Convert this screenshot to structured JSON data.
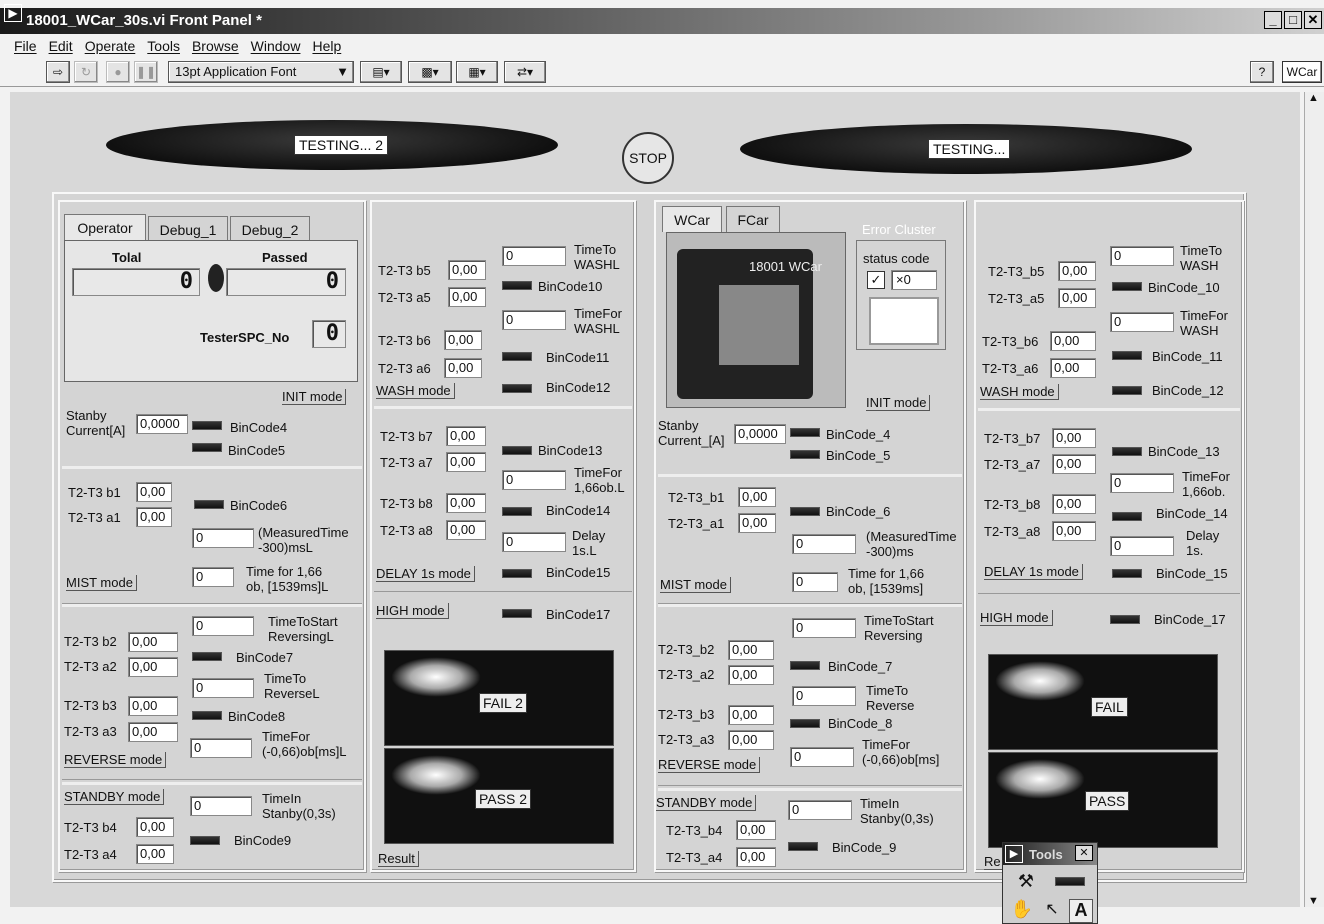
{
  "window": {
    "title": "18001_WCar_30s.vi Front Panel *",
    "right_tab": "WCar"
  },
  "menu": [
    "File",
    "Edit",
    "Operate",
    "Tools",
    "Browse",
    "Window",
    "Help"
  ],
  "toolbar": {
    "font": "13pt Application Font"
  },
  "status": {
    "left": "TESTING... 2",
    "right": "TESTING...",
    "stop": "STOP"
  },
  "left": {
    "tabs": [
      "Operator",
      "Debug_1",
      "Debug_2"
    ],
    "tolal_label": "Tolal",
    "tolal_value": "0",
    "passed_label": "Passed",
    "passed_value": "0",
    "tester_label": "TesterSPC_No",
    "tester_value": "0",
    "init_mode": "INIT mode",
    "stanby_label": "Stanby\nCurrent[A]",
    "stanby_value": "0,0000",
    "bin4": "BinCode4",
    "bin5": "BinCode5",
    "mist": {
      "l1": "T2-T3 b1",
      "v1": "0,00",
      "l2": "T2-T3 a1",
      "v2": "0,00",
      "bin": "BinCode6",
      "n1": "0",
      "t1": "(MeasuredTime\n-300)msL",
      "n2": "0",
      "t2": "Time for 1,66\nob, [1539ms]L",
      "mode": "MIST mode"
    },
    "reverse": {
      "n1": "0",
      "t1": "TimeToStart\nReversingL",
      "l1": "T2-T3 b2",
      "v1": "0,00",
      "l2": "T2-T3 a2",
      "v2": "0,00",
      "bin7": "BinCode7",
      "n2": "0",
      "t2": "TimeTo\nReverseL",
      "l3": "T2-T3 b3",
      "v3": "0,00",
      "l4": "T2-T3 a3",
      "v4": "0,00",
      "bin8": "BinCode8",
      "n3": "0",
      "t3": "TimeFor\n(-0,66)ob[ms]L",
      "mode": "REVERSE mode"
    },
    "standby": {
      "mode": "STANDBY mode",
      "n1": "0",
      "t1": "TimeIn\nStanby(0,3s)",
      "l1": "T2-T3 b4",
      "v1": "0,00",
      "l2": "T2-T3 a4",
      "v2": "0,00",
      "bin": "BinCode9"
    }
  },
  "mid": {
    "wash": {
      "l1": "T2-T3 b5",
      "v1": "0,00",
      "l2": "T2-T3 a5",
      "v2": "0,00",
      "n1": "0",
      "t1": "TimeTo\nWASHL",
      "bin10": "BinCode10",
      "n2": "0",
      "t2": "TimeFor\nWASHL",
      "l3": "T2-T3 b6",
      "v3": "0,00",
      "l4": "T2-T3 a6",
      "v4": "0,00",
      "bin11": "BinCode11",
      "bin12": "BinCode12",
      "mode": "WASH mode"
    },
    "delay": {
      "l1": "T2-T3 b7",
      "v1": "0,00",
      "l2": "T2-T3 a7",
      "v2": "0,00",
      "bin13": "BinCode13",
      "n1": "0",
      "t1": "TimeFor\n1,66ob.L",
      "l3": "T2-T3 b8",
      "v3": "0,00",
      "l4": "T2-T3 a8",
      "v4": "0,00",
      "bin14": "BinCode14",
      "n2": "0",
      "t2": "Delay\n1s.L",
      "bin15": "BinCode15",
      "mode": "DELAY 1s mode"
    },
    "high": {
      "mode": "HIGH mode",
      "bin": "BinCode17"
    },
    "fail": "FAIL 2",
    "pass": "PASS 2",
    "result": "Result"
  },
  "right": {
    "tabs": [
      "WCar",
      "FCar"
    ],
    "photo_text": "18001  WCar",
    "error_title": "Error Cluster",
    "status_code": "status code",
    "code_value": "0",
    "init_mode": "INIT mode",
    "stanby_label": "Stanby\nCurrent_[A]",
    "stanby_value": "0,0000",
    "bin4": "BinCode_4",
    "bin5": "BinCode_5",
    "mist": {
      "l1": "T2-T3_b1",
      "v1": "0,00",
      "l2": "T2-T3_a1",
      "v2": "0,00",
      "bin": "BinCode_6",
      "n1": "0",
      "t1": "(MeasuredTime\n-300)ms",
      "n2": "0",
      "t2": "Time for 1,66\nob, [1539ms]",
      "mode": "MIST mode"
    },
    "reverse": {
      "n1": "0",
      "t1": "TimeToStart\nReversing",
      "l1": "T2-T3_b2",
      "v1": "0,00",
      "l2": "T2-T3_a2",
      "v2": "0,00",
      "bin7": "BinCode_7",
      "n2": "0",
      "t2": "TimeTo\nReverse",
      "l3": "T2-T3_b3",
      "v3": "0,00",
      "l4": "T2-T3_a3",
      "v4": "0,00",
      "bin8": "BinCode_8",
      "n3": "0",
      "t3": "TimeFor\n(-0,66)ob[ms]",
      "mode": "REVERSE mode"
    },
    "standby": {
      "mode": "STANDBY mode",
      "n1": "0",
      "t1": "TimeIn\nStanby(0,3s)",
      "l1": "T2-T3_b4",
      "v1": "0,00",
      "l2": "T2-T3_a4",
      "v2": "0,00",
      "bin": "BinCode_9"
    }
  },
  "far": {
    "wash": {
      "l1": "T2-T3_b5",
      "v1": "0,00",
      "l2": "T2-T3_a5",
      "v2": "0,00",
      "n1": "0",
      "t1": "TimeTo\nWASH",
      "bin10": "BinCode_10",
      "n2": "0",
      "t2": "TimeFor\nWASH",
      "l3": "T2-T3_b6",
      "v3": "0,00",
      "l4": "T2-T3_a6",
      "v4": "0,00",
      "bin11": "BinCode_11",
      "bin12": "BinCode_12",
      "mode": "WASH mode"
    },
    "delay": {
      "l1": "T2-T3_b7",
      "v1": "0,00",
      "l2": "T2-T3_a7",
      "v2": "0,00",
      "bin13": "BinCode_13",
      "n1": "0",
      "t1": "TimeFor\n1,66ob.",
      "l3": "T2-T3_b8",
      "v3": "0,00",
      "l4": "T2-T3_a8",
      "v4": "0,00",
      "bin14": "BinCode_14",
      "n2": "0",
      "t2": "Delay\n1s.",
      "bin15": "BinCode_15",
      "mode": "DELAY 1s mode"
    },
    "high": {
      "mode": "HIGH mode",
      "bin": "BinCode_17"
    },
    "fail": "FAIL",
    "pass": "PASS",
    "result": "Re",
    "tools": "Tools"
  }
}
